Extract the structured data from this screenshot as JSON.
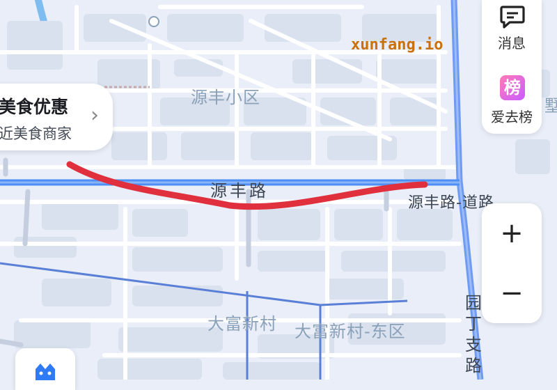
{
  "map": {
    "colors": {
      "background": "#e9eef8",
      "block": "#d9e1ee",
      "street": "#ffffff",
      "main_road": "#4d8ff5",
      "branch_road": "#5a7fd6",
      "route": "#e0303d",
      "water": "#7fbcf0"
    },
    "labels": {
      "district_1": "源丰小区",
      "road_main": "源丰路",
      "road_east": "源丰路-道路",
      "district_2": "大富新村",
      "district_3": "大富新村-东区",
      "road_vertical": "园丁支路",
      "edge_char": "墅"
    },
    "watermark": "xunfang.io"
  },
  "promo": {
    "title": "美食优惠",
    "subtitle": "近美食商家",
    "chevron_icon": "chevron-right-icon"
  },
  "side_panel": {
    "message_label": "消息",
    "message_icon": "message-icon",
    "rank_label": "爱去榜",
    "rank_icon_text": "榜",
    "rank_icon": "rank-badge-icon"
  },
  "zoom": {
    "in_label": "+",
    "out_label": "−",
    "in_icon": "plus-icon",
    "out_icon": "minus-icon"
  },
  "bottom_button": {
    "icon": "navigation-icon"
  }
}
